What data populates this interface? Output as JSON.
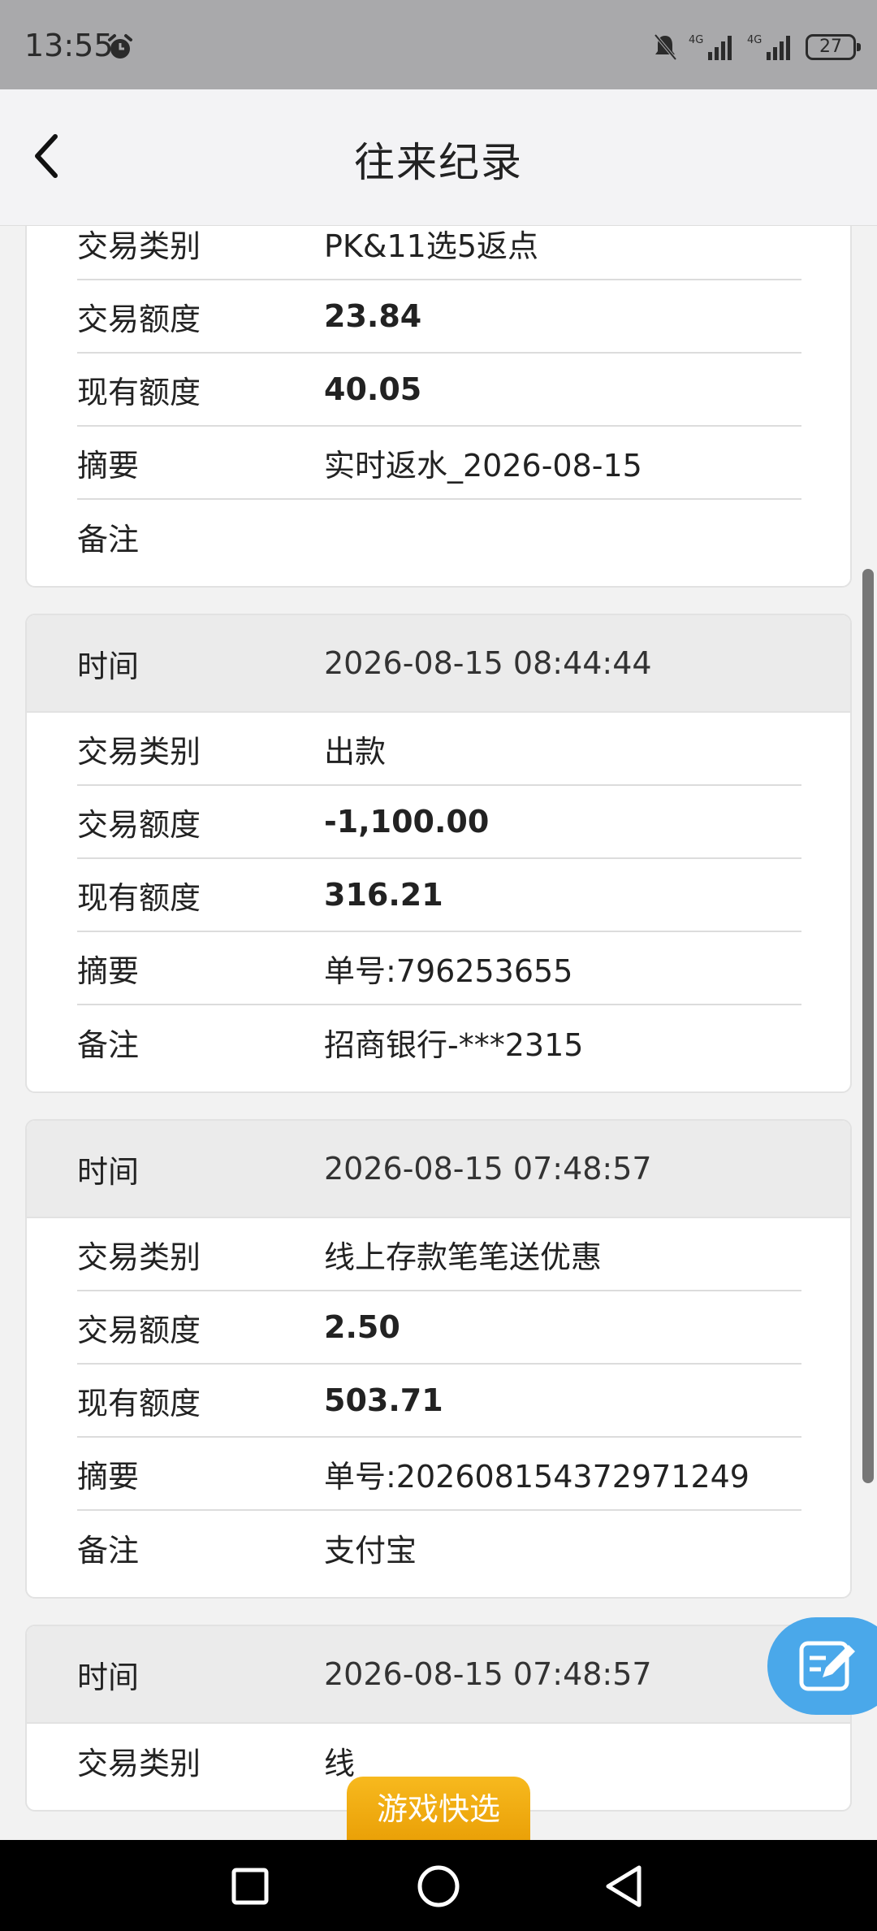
{
  "status_bar": {
    "time": "13:55",
    "battery": "27",
    "network": "4G"
  },
  "header": {
    "title": "往来纪录"
  },
  "records": [
    {
      "rows": [
        {
          "label": "交易类别",
          "value": "PK&11选5返点",
          "bold": false
        },
        {
          "label": "交易额度",
          "value": "23.84",
          "bold": true
        },
        {
          "label": "现有额度",
          "value": "40.05",
          "bold": true
        },
        {
          "label": "摘要",
          "value": "实时返水_2026-08-15",
          "bold": false
        },
        {
          "label": "备注",
          "value": "",
          "bold": false
        }
      ]
    },
    {
      "time_label": "时间",
      "time": "2026-08-15 08:44:44",
      "rows": [
        {
          "label": "交易类别",
          "value": "出款",
          "bold": false
        },
        {
          "label": "交易额度",
          "value": "-1,100.00",
          "bold": true
        },
        {
          "label": "现有额度",
          "value": "316.21",
          "bold": true
        },
        {
          "label": "摘要",
          "value": "单号:796253655",
          "bold": false
        },
        {
          "label": "备注",
          "value": "招商银行-***2315",
          "bold": false
        }
      ]
    },
    {
      "time_label": "时间",
      "time": "2026-08-15 07:48:57",
      "rows": [
        {
          "label": "交易类别",
          "value": "线上存款笔笔送优惠",
          "bold": false
        },
        {
          "label": "交易额度",
          "value": "2.50",
          "bold": true
        },
        {
          "label": "现有额度",
          "value": "503.71",
          "bold": true
        },
        {
          "label": "摘要",
          "value": "单号:202608154372971249",
          "bold": false
        },
        {
          "label": "备注",
          "value": "支付宝",
          "bold": false
        }
      ]
    },
    {
      "time_label": "时间",
      "time": "2026-08-15 07:48:57",
      "rows": [
        {
          "label": "交易类别",
          "value": "线",
          "bold": false
        }
      ]
    }
  ],
  "game_quick": {
    "label": "游戏快选"
  },
  "icons": {
    "back": "chevron-left-icon",
    "edit": "edit-icon",
    "alarm": "alarm-icon",
    "nav_recent": "square-icon",
    "nav_home": "circle-icon",
    "nav_back": "triangle-back-icon"
  },
  "colors": {
    "accent_float": "#4aa8ea",
    "game_quick": "#f2ac12"
  }
}
